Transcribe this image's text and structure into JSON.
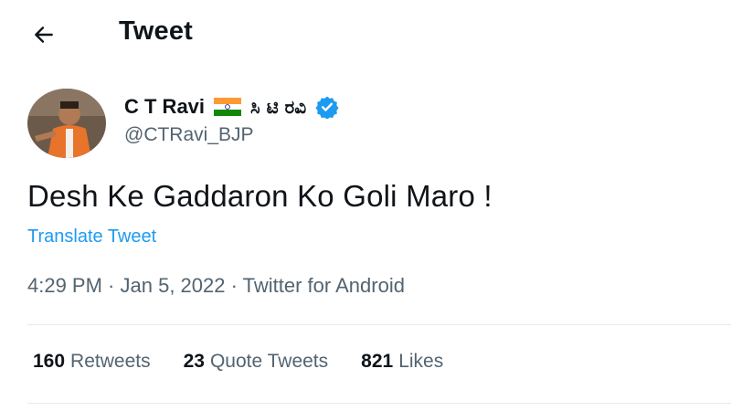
{
  "header": {
    "title": "Tweet",
    "back_icon": "arrow-left-icon"
  },
  "author": {
    "display_name": "C T Ravi",
    "flag_icon": "india-flag-icon",
    "name_kannada": "ಸಿ ಟಿ ರವಿ",
    "verified_icon": "verified-badge-icon",
    "handle": "@CTRavi_BJP"
  },
  "tweet": {
    "text": "Desh Ke Gaddaron Ko Goli Maro !",
    "translate_label": "Translate Tweet",
    "time": "4:29 PM",
    "date": "Jan 5, 2022",
    "source": "Twitter for Android",
    "separator": " · "
  },
  "stats": [
    {
      "count": "160",
      "label": "Retweets"
    },
    {
      "count": "23",
      "label": "Quote Tweets"
    },
    {
      "count": "821",
      "label": "Likes"
    }
  ],
  "colors": {
    "accent": "#1d9bf0",
    "secondary_text": "#536471",
    "primary_text": "#0f1419"
  }
}
